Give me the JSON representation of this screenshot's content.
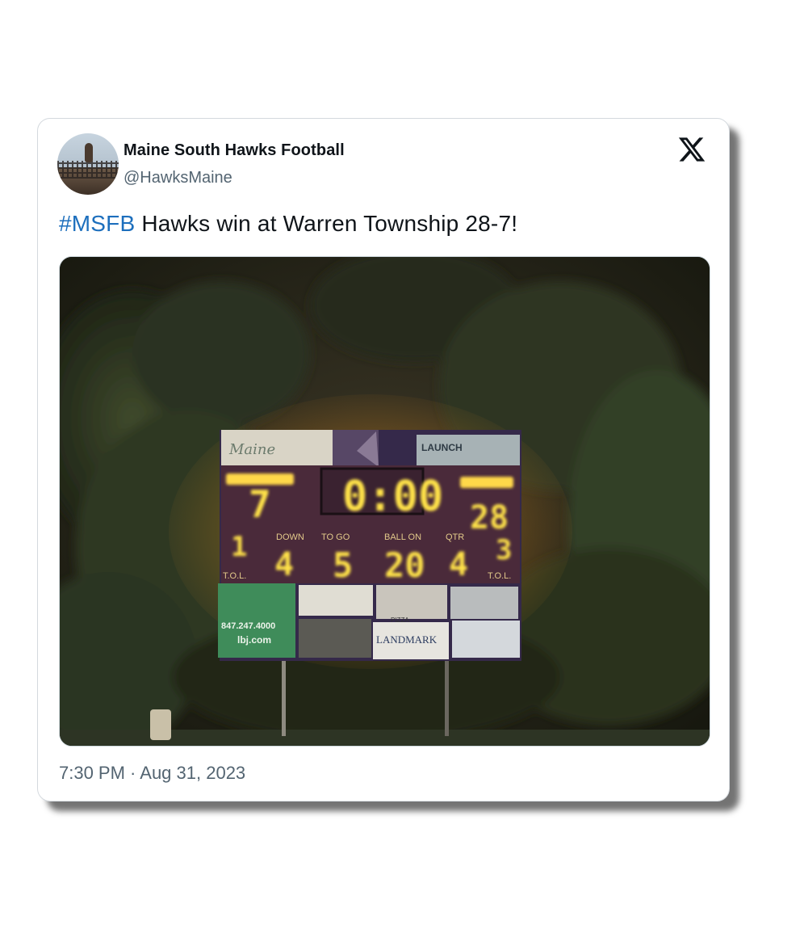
{
  "tweet": {
    "author_name": "Maine South Hawks Football",
    "author_handle": "@HawksMaine",
    "hashtag": "#MSFB",
    "text": " Hawks win at Warren Township 28-7!",
    "timestamp": "7:30 PM · Aug 31, 2023"
  },
  "icons": {
    "platform": "x-logo-icon",
    "avatar": "hawk-avatar"
  },
  "scoreboard": {
    "guest_score": "7",
    "home_score": "28",
    "clock": "0:00",
    "down_label": "DOWN",
    "down_value": "4",
    "to_go_label": "TO GO",
    "to_go_value": "5",
    "ball_on_label": "BALL ON",
    "ball_on_value": "20",
    "qtr_label": "QTR",
    "qtr_value": "4",
    "guest_tol_value": "1",
    "home_tol_value": "3",
    "tol_label": "T.O.L.",
    "sponsor_launch": "LAUNCH",
    "sponsor_phone": "847.247.4000",
    "sponsor_web": "lbj.com",
    "sponsor_landmark": "LANDMARK",
    "sponsor_pizza": "PIZZA",
    "sponsor_main": "Maine"
  },
  "colors": {
    "link": "#1d6fbd",
    "text": "#0f1419",
    "muted": "#536471",
    "digit": "#ffe24a",
    "glow": "#ff9a1a"
  }
}
